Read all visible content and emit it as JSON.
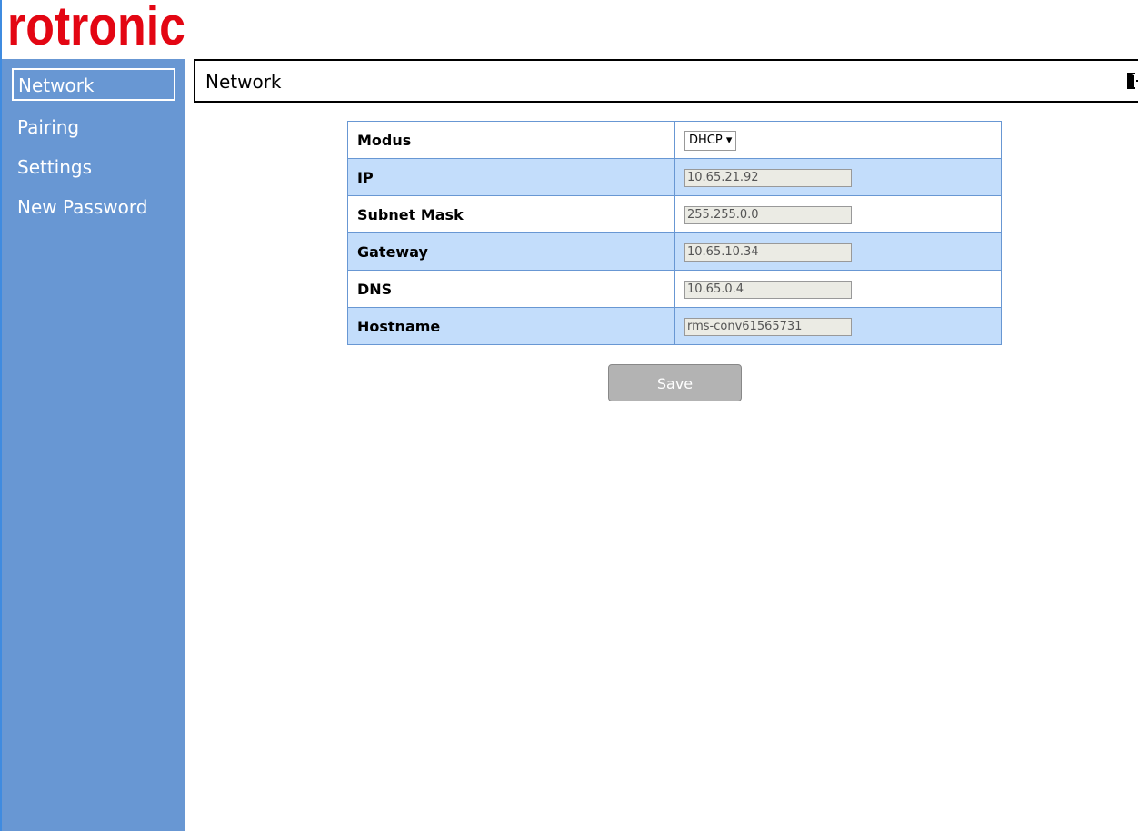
{
  "brand": {
    "logo_text": "rotronic",
    "color": "#e30613"
  },
  "sidebar": {
    "items": [
      {
        "label": "Network",
        "active": true
      },
      {
        "label": "Pairing"
      },
      {
        "label": "Settings"
      },
      {
        "label": "New Password"
      }
    ]
  },
  "header": {
    "title": "Network",
    "logout_icon": "logout-door-icon"
  },
  "form": {
    "modus": {
      "label": "Modus",
      "value": "DHCP"
    },
    "rows": [
      {
        "label": "IP",
        "value": "10.65.21.92"
      },
      {
        "label": "Subnet Mask",
        "value": "255.255.0.0"
      },
      {
        "label": "Gateway",
        "value": "10.65.10.34"
      },
      {
        "label": "DNS",
        "value": "10.65.0.4"
      },
      {
        "label": "Hostname",
        "value": "rms-conv61565731"
      }
    ],
    "save_label": "Save"
  }
}
